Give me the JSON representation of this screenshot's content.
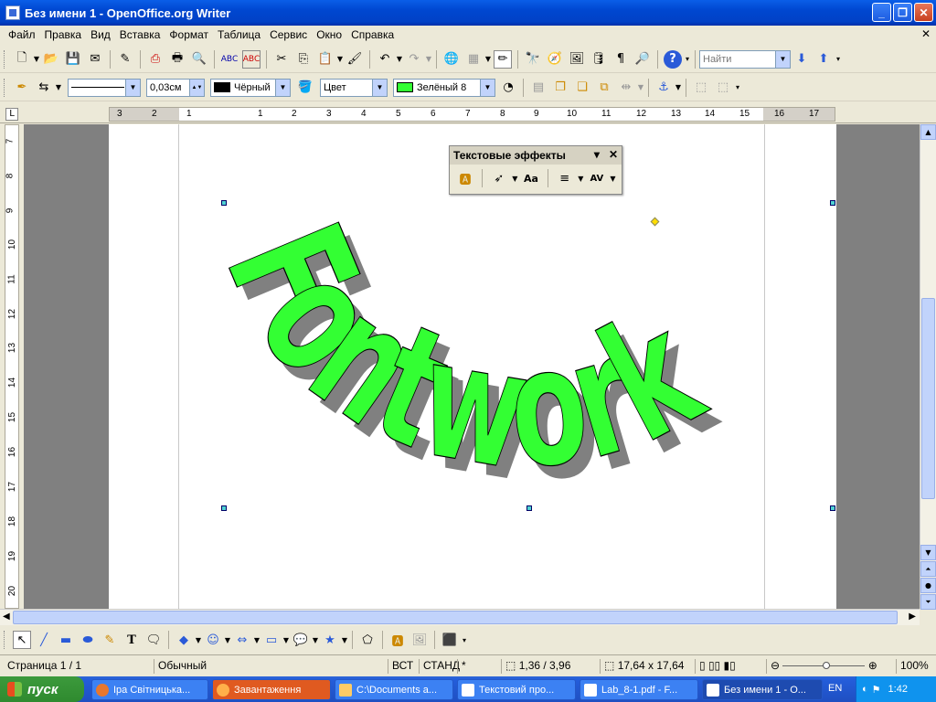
{
  "window": {
    "title": "Без имени 1 - OpenOffice.org Writer"
  },
  "menu": [
    "Файл",
    "Правка",
    "Вид",
    "Вставка",
    "Формат",
    "Таблица",
    "Сервис",
    "Окно",
    "Справка"
  ],
  "toolbar_main": {
    "find_placeholder": "Найти"
  },
  "toolbar_frame": {
    "line_width": "0,03см",
    "line_color_name": "Чёрный",
    "area_type": "Цвет",
    "area_color_name": "Зелёный 8",
    "line_color": "#000000",
    "area_color": "#33ff33"
  },
  "fontwork_toolbar": {
    "title": "Текстовые эффекты"
  },
  "fontwork": {
    "text": "Fontwork",
    "fill_color": "#33ff33",
    "shadow_color": "#808080"
  },
  "ruler": {
    "h_labels": [
      "3",
      "2",
      "1",
      "1",
      "2",
      "3",
      "4",
      "5",
      "6",
      "7",
      "8",
      "9",
      "10",
      "11",
      "12",
      "13",
      "14",
      "15",
      "16",
      "17"
    ],
    "v_labels": [
      "7",
      "8",
      "9",
      "10",
      "11",
      "12",
      "13",
      "14",
      "15",
      "16",
      "17",
      "18",
      "19",
      "20"
    ]
  },
  "status": {
    "page": "Страница  1 / 1",
    "style": "Обычный",
    "insert_mode": "ВСТ",
    "selection_mode": "СТАНД",
    "modified": "*",
    "position": "1,36 / 3,96",
    "size": "17,64 x 17,64",
    "zoom": "100%"
  },
  "taskbar": {
    "start": "пуск",
    "tasks": [
      "Іра Світницька...",
      "Завантаження",
      "C:\\Documents a...",
      "Текстовий про...",
      "Lab_8-1.pdf - F...",
      "Без имени 1 - O..."
    ],
    "lang": "EN",
    "clock": "1:42"
  }
}
